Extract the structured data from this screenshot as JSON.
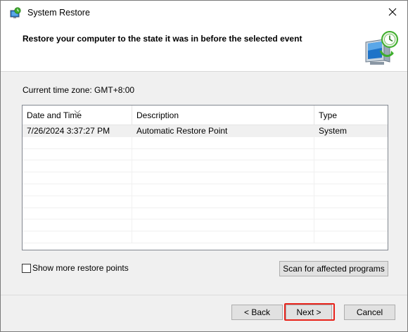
{
  "window": {
    "title": "System Restore",
    "title_icon": "system-restore-icon",
    "close_icon": "close-icon"
  },
  "header": {
    "title": "Restore your computer to the state it was in before the selected event",
    "icon": "system-restore-monitor-icon"
  },
  "timezone": {
    "label": "Current time zone: GMT+8:00"
  },
  "table": {
    "columns": [
      "Date and Time",
      "Description",
      "Type"
    ],
    "sort_indicator": "sort-descending-icon",
    "rows": [
      {
        "date": "7/26/2024 3:37:27 PM",
        "description": "Automatic Restore Point",
        "type": "System",
        "selected": true
      }
    ]
  },
  "options": {
    "show_more_label": "Show more restore points",
    "show_more_checked": false
  },
  "buttons": {
    "scan": "Scan for affected programs",
    "back": "< Back",
    "next": "Next >",
    "cancel": "Cancel"
  },
  "colors": {
    "highlight": "#e8231b",
    "accent_green": "#3dae2b",
    "accent_blue": "#1e73c8"
  }
}
